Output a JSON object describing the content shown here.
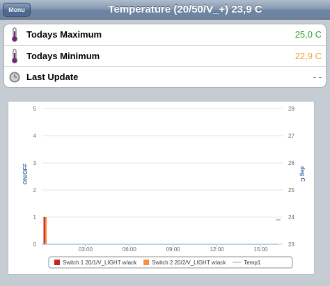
{
  "header": {
    "menu_label": "Menu",
    "title": "Temperature (20/50/V_+) 23,9 C"
  },
  "rows": [
    {
      "label": "Todays Maximum",
      "value": "25,0 C",
      "value_color": "#2da12d",
      "icon": "thermometer-icon"
    },
    {
      "label": "Todays Minimum",
      "value": "22,9 C",
      "value_color": "#f0a030",
      "icon": "thermometer-icon"
    },
    {
      "label": "Last Update",
      "value": "- -",
      "value_color": "#4a6b8a",
      "icon": "clock-icon"
    }
  ],
  "chart_data": {
    "type": "line",
    "ylabel_left": "ON/OFF",
    "ylabel_right": "deg C",
    "left_ylim": [
      0,
      5
    ],
    "right_ylim": [
      23,
      28
    ],
    "left_ticks": [
      "0",
      "1",
      "2",
      "3",
      "4",
      "5"
    ],
    "right_ticks": [
      "23",
      "24",
      "25",
      "26",
      "27",
      "28"
    ],
    "x_ticks": [
      "03:00",
      "06:00",
      "09:00",
      "12:00",
      "15:00"
    ],
    "x_tick_hours": [
      3,
      6,
      9,
      12,
      15
    ],
    "x_range_hours": [
      0,
      16.5
    ],
    "grid": true,
    "legend_position": "bottom",
    "series": [
      {
        "name": "Switch 1 20/1/V_LIGHT w/ack",
        "color": "#c42525",
        "kind": "bar",
        "axis": "left",
        "points": [
          [
            0.12,
            1
          ]
        ]
      },
      {
        "name": "Switch 2 20/2/V_LIGHT w/ack",
        "color": "#f28f43",
        "kind": "bar",
        "axis": "left",
        "points": [
          [
            0.22,
            1
          ]
        ]
      },
      {
        "name": "Temp1",
        "color": "#a0c4e4",
        "kind": "line",
        "axis": "right",
        "points": [
          [
            0.0,
            23.0
          ],
          [
            16.2,
            23.0
          ]
        ],
        "endpoint": [
          16.2,
          23.9
        ]
      }
    ]
  }
}
